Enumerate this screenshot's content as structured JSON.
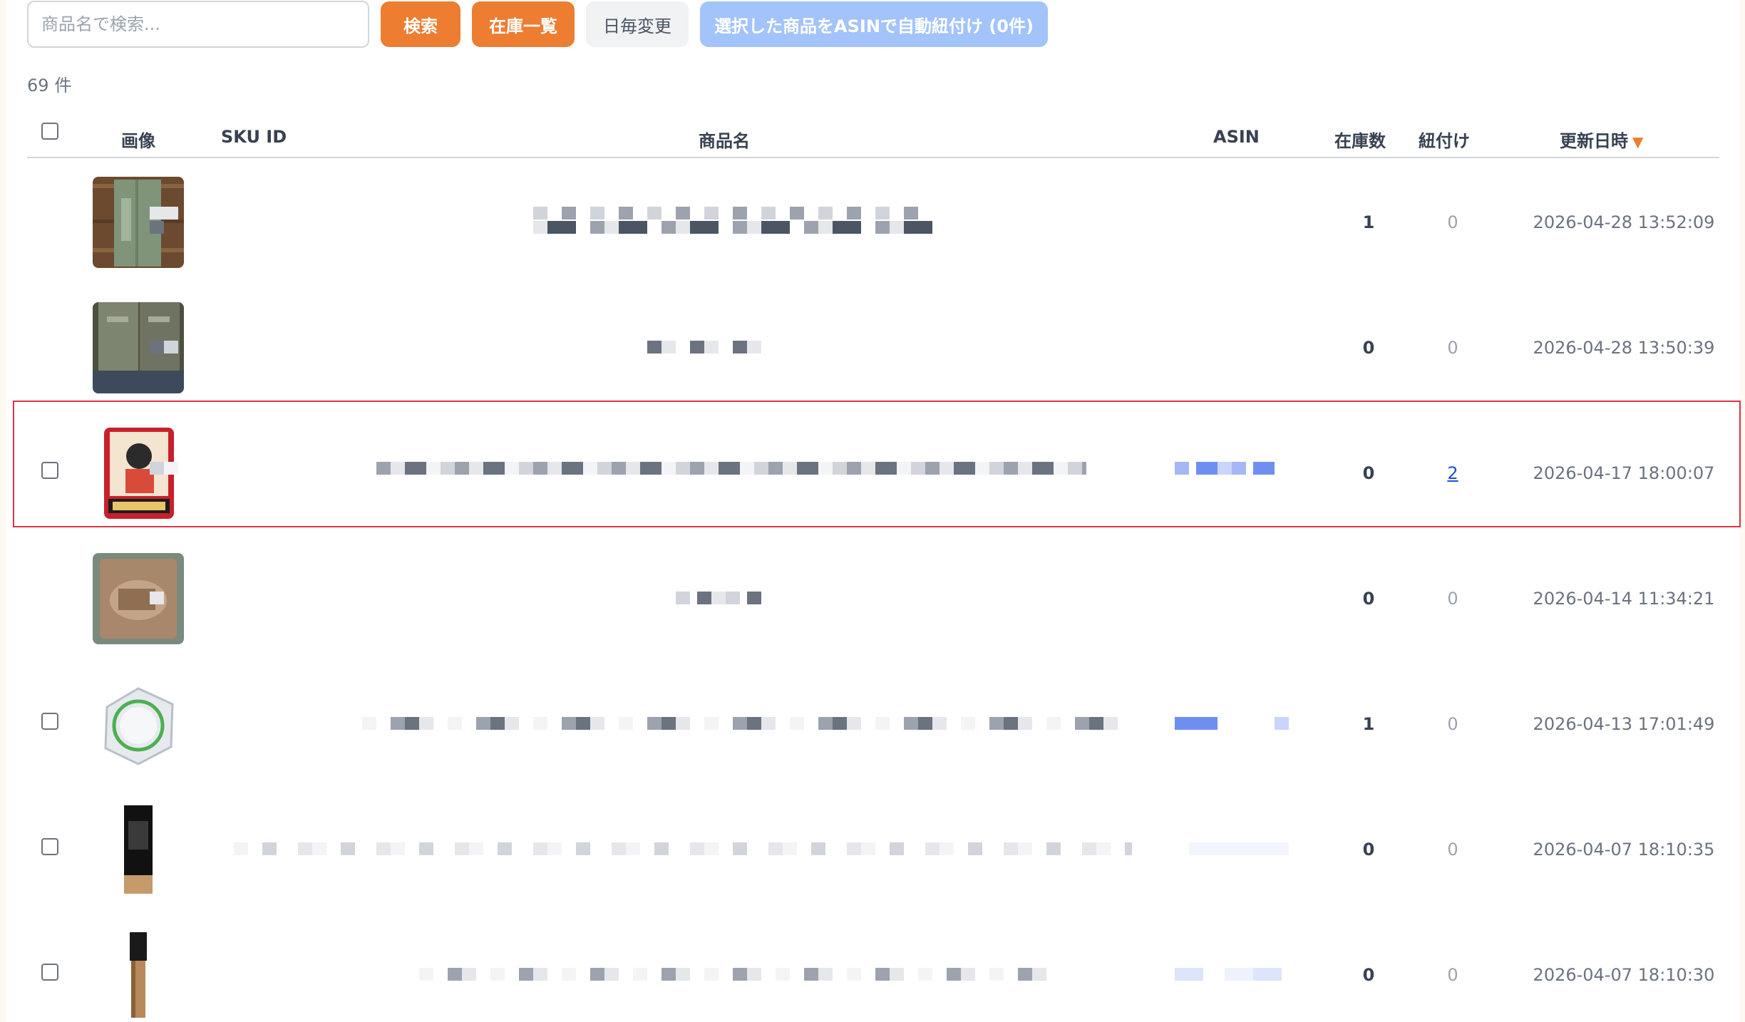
{
  "toolbar": {
    "search_placeholder": "商品名で検索...",
    "search_label": "検索",
    "inventory_label": "在庫一覧",
    "daily_label": "日毎変更",
    "asin_label": "選択した商品をASINで自動紐付け (0件)"
  },
  "result": {
    "count": "69",
    "suffix": "件"
  },
  "columns": {
    "image": "画像",
    "sku": "SKU ID",
    "name": "商品名",
    "asin": "ASIN",
    "stock": "在庫数",
    "linked": "紐付け",
    "updated": "更新日時"
  },
  "rows": [
    {
      "stock": "1",
      "linked": "0",
      "updated": "2026-04-28 13:52:09",
      "has_checkbox": false
    },
    {
      "stock": "0",
      "linked": "0",
      "updated": "2026-04-28 13:50:39",
      "has_checkbox": false
    },
    {
      "stock": "0",
      "linked": "2",
      "updated": "2026-04-17 18:00:07",
      "has_checkbox": true,
      "highlighted": true
    },
    {
      "stock": "0",
      "linked": "0",
      "updated": "2026-04-14 11:34:21",
      "has_checkbox": false
    },
    {
      "stock": "1",
      "linked": "0",
      "updated": "2026-04-13 17:01:49",
      "has_checkbox": true
    },
    {
      "stock": "0",
      "linked": "0",
      "updated": "2026-04-07 18:10:35",
      "has_checkbox": true
    },
    {
      "stock": "0",
      "linked": "0",
      "updated": "2026-04-07 18:10:30",
      "has_checkbox": true
    }
  ],
  "colors": {
    "accent": "#ed7d31",
    "link": "#1d4ed8",
    "highlight_border": "#dc3545",
    "asin_button": "#a3c3fb"
  },
  "icons": {
    "sort": "sort-desc-icon"
  }
}
